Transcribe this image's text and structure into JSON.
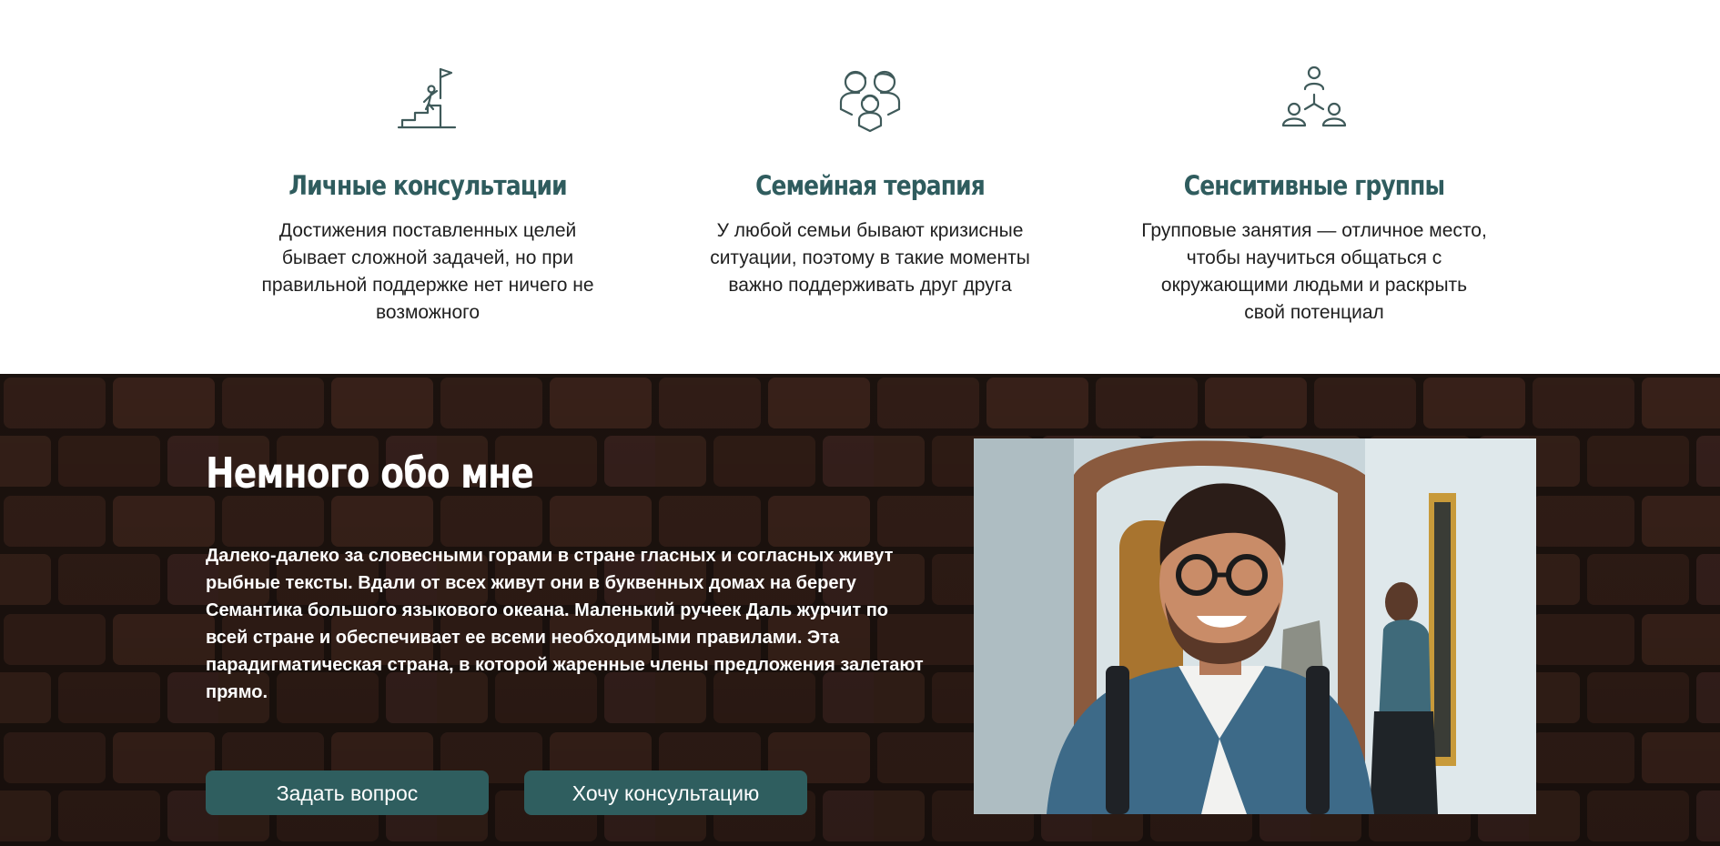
{
  "services": [
    {
      "icon": "goal-stairs-flag-icon",
      "title": "Личные консультации",
      "description": "Достижения поставленных целей бывает сложной задачей, но при правильной поддержке нет ничего не возможного"
    },
    {
      "icon": "family-icon",
      "title": "Семейная терапия",
      "description": "У любой семьи бывают кризисные ситуации, поэтому в такие моменты важно поддерживать друг друга"
    },
    {
      "icon": "group-network-icon",
      "title": "Сенситивные группы",
      "description": "Групповые занятия — отличное место, чтобы научиться общаться с окружающими людьми и раскрыть свой потенциал"
    }
  ],
  "about": {
    "title": "Немного обо мне",
    "text": "Далеко-далеко за словесными горами в стране гласных и согласных живут рыбные тексты. Вдали от всех живут они в буквенных домах на берегу Семантика большого языкового океана. Маленький ручеек Даль журчит по всей стране и обеспечивает ее всеми необходимыми правилами. Эта парадигматическая страна, в которой жаренные члены предложения залетают прямо.",
    "buttons": {
      "ask": "Задать вопрос",
      "consult": "Хочу консультацию"
    },
    "photo": "smiling-man-portrait"
  },
  "colors": {
    "accent": "#2f5e5f",
    "title": "#2f5c5e",
    "brick_dark": "#2b1d17"
  }
}
